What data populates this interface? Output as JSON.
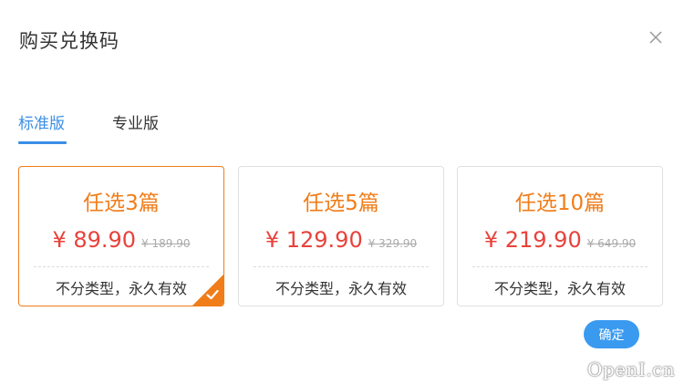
{
  "dialog": {
    "title": "购买兑换码",
    "close_icon": "close-icon",
    "confirm_label": "确定"
  },
  "tabs": [
    {
      "label": "标准版",
      "active": true
    },
    {
      "label": "专业版",
      "active": false
    }
  ],
  "plans": [
    {
      "name": "任选3篇",
      "price": "¥ 89.90",
      "original_price": "¥ 189.90",
      "description": "不分类型，永久有效",
      "selected": true
    },
    {
      "name": "任选5篇",
      "price": "¥ 129.90",
      "original_price": "¥ 329.90",
      "description": "不分类型，永久有效",
      "selected": false
    },
    {
      "name": "任选10篇",
      "price": "¥ 219.90",
      "original_price": "¥ 649.90",
      "description": "不分类型，永久有效",
      "selected": false
    }
  ],
  "colors": {
    "accent_blue": "#3a8ee6",
    "accent_orange": "#f07d1a",
    "price_red": "#e8423b",
    "confirm_button": "#3a9af0"
  },
  "watermark": "OpenI.cn"
}
